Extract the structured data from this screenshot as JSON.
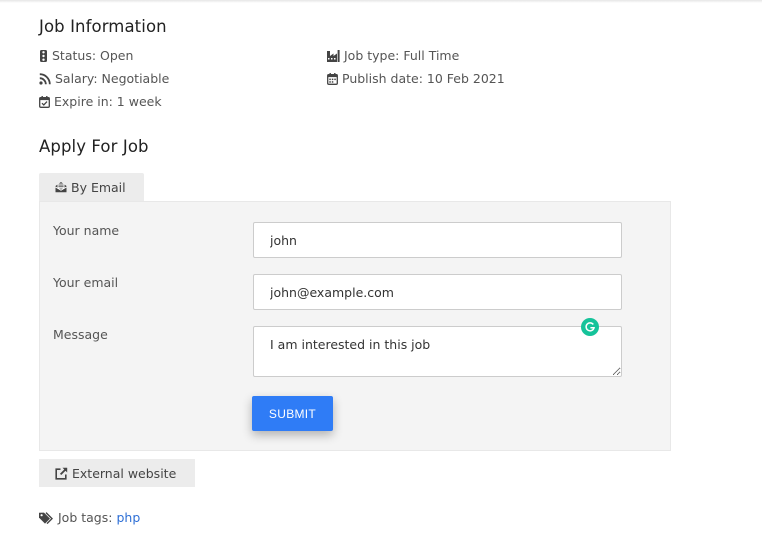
{
  "job_info": {
    "title": "Job Information",
    "status": "Status: Open",
    "salary": "Salary: Negotiable",
    "expire": "Expire in: 1 week",
    "job_type": "Job type: Full Time",
    "publish_date": "Publish date: 10 Feb 2021"
  },
  "apply": {
    "title": "Apply For Job",
    "tab_label": "By Email",
    "name_label": "Your name",
    "name_value": "john",
    "email_label": "Your email",
    "email_value": "john@example.com",
    "message_label": "Message",
    "message_value": "I am interested in this job",
    "submit_label": "SUBMIT",
    "external_label": "External website"
  },
  "tags": {
    "label": "Job tags:",
    "values": [
      "php"
    ]
  },
  "colors": {
    "accent": "#2f7cf6",
    "link": "#2e6fd6",
    "grammarly": "#15c39a"
  }
}
